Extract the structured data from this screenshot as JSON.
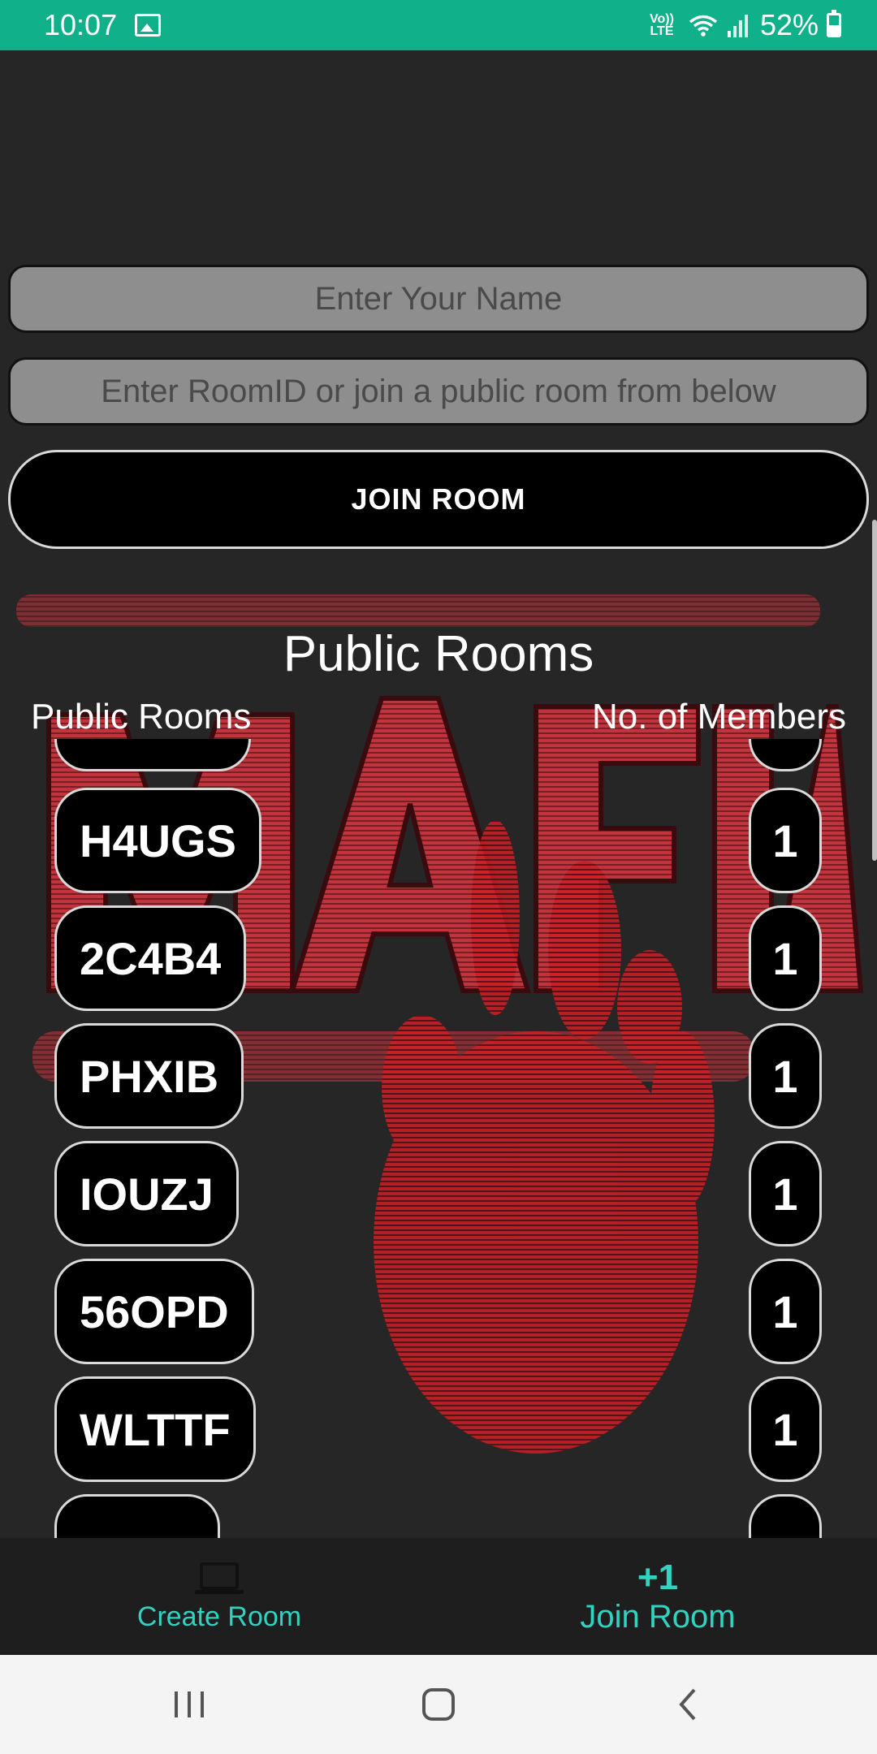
{
  "status_bar": {
    "time": "10:07",
    "volte_line1": "Vo))",
    "volte_line2": "LTE",
    "battery": "52%"
  },
  "form": {
    "name_placeholder": "Enter Your Name",
    "room_placeholder": "Enter RoomID or join a public room from below",
    "join_button": "JOIN ROOM"
  },
  "rooms": {
    "title": "Public Rooms",
    "col_rooms": "Public Rooms",
    "col_members": "No. of Members",
    "items": [
      {
        "id": "",
        "members": ""
      },
      {
        "id": "H4UGS",
        "members": "1"
      },
      {
        "id": "2C4B4",
        "members": "1"
      },
      {
        "id": "PHXIB",
        "members": "1"
      },
      {
        "id": "IOUZJ",
        "members": "1"
      },
      {
        "id": "56OPD",
        "members": "1"
      },
      {
        "id": "WLTTF",
        "members": "1"
      },
      {
        "id": "",
        "members": ""
      }
    ]
  },
  "bottom_nav": {
    "create_label": "Create Room",
    "join_icon": "+1",
    "join_label": "Join Room"
  },
  "colors": {
    "status_bar": "#10b08a",
    "accent": "#2fd3c0",
    "background": "#262626",
    "poster_red": "#c0353d"
  },
  "icons": {
    "status": [
      "gallery-icon",
      "wifi-icon",
      "signal-icon",
      "battery-icon"
    ],
    "nav": [
      "laptop-icon"
    ],
    "system": [
      "recents-icon",
      "home-icon",
      "back-icon"
    ]
  }
}
